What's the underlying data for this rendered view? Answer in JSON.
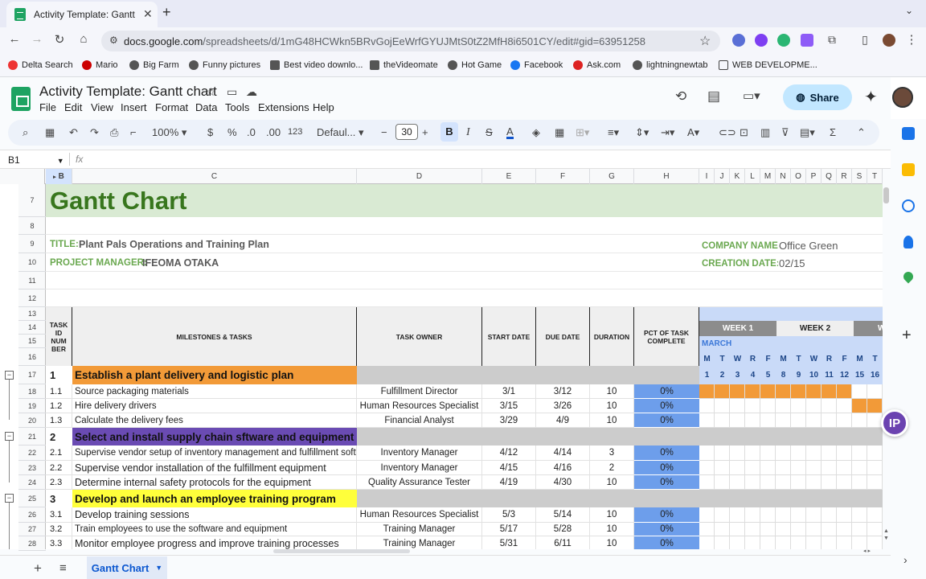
{
  "browser": {
    "tab_title": "Activity Template: Gantt char",
    "tab_close": "✕",
    "new_tab": "+",
    "tab_menu": "⌄",
    "url_host": "docs.google.com",
    "url_path": "/spreadsheets/d/1mG48HCWkn5BRvGojEeWrfGYUJMtS0tZ2MfH8i6501CY/edit#gid=63951258",
    "bookmarks": [
      "Delta Search",
      "Mario",
      "Big Farm",
      "Funny pictures",
      "Best video downlo...",
      "theVideomate",
      "Hot Game",
      "Facebook",
      "Ask.com",
      "lightningnewtab",
      "WEB DEVELOPME..."
    ]
  },
  "app": {
    "doc_title": "Activity Template: Gantt chart",
    "menus": [
      "File",
      "Edit",
      "View",
      "Insert",
      "Format",
      "Data",
      "Tools",
      "Extensions",
      "Help"
    ],
    "share_label": "Share",
    "zoom": "100%",
    "currency": "$",
    "percent": "%",
    "dec_dec": ".0",
    "dec_inc": ".00",
    "num_format": "123",
    "font_name": "Defaul...",
    "font_size": "30",
    "bold": "B",
    "italic": "I",
    "namebox": "B1",
    "fx": "fx",
    "sheet_tab": "Gantt Chart"
  },
  "columns": [
    "B",
    "C",
    "D",
    "E",
    "F",
    "G",
    "H",
    "I",
    "J",
    "K",
    "L",
    "M",
    "N",
    "O",
    "P",
    "Q",
    "R",
    "S",
    "T"
  ],
  "row_numbers": [
    "7",
    "8",
    "9",
    "10",
    "11",
    "12",
    "13",
    "14",
    "15",
    "16",
    "17",
    "18",
    "19",
    "20",
    "21",
    "22",
    "23",
    "24",
    "25",
    "26",
    "27",
    "28"
  ],
  "sheet": {
    "title": "Gantt Chart",
    "title_label": "TITLE:",
    "title_value": "Plant Pals Operations and Training Plan",
    "pm_label": "PROJECT MANAGER:",
    "pm_value": "IFEOMA OTAKA",
    "company_label": "COMPANY NAME:",
    "company_value": "Office Green",
    "creation_label": "CREATION DATE:",
    "creation_value": "02/15",
    "headers": {
      "task_id": "TASK ID NUM BER",
      "milestones": "MILESTONES & TASKS",
      "owner": "TASK OWNER",
      "start": "START DATE",
      "due": "DUE DATE",
      "duration": "DURATION",
      "pct": "PCT OF TASK COMPLETE",
      "week1": "WEEK 1",
      "week2": "WEEK 2",
      "week3": "W",
      "month": "MARCH",
      "days": [
        "M",
        "T",
        "W",
        "R",
        "F",
        "M",
        "T",
        "W",
        "R",
        "F",
        "M",
        "T"
      ],
      "dates": [
        "1",
        "2",
        "3",
        "4",
        "5",
        "8",
        "9",
        "10",
        "11",
        "12",
        "15",
        "16"
      ]
    },
    "phases": [
      {
        "num": "1",
        "name": "Establish a plant delivery and logistic plan",
        "color": "#f29a38",
        "tasks": [
          {
            "id": "1.1",
            "name": "Source packaging materials",
            "owner": "Fulfillment Director",
            "start": "3/1",
            "due": "3/12",
            "duration": "10",
            "pct": "0%"
          },
          {
            "id": "1.2",
            "name": "Hire delivery drivers",
            "owner": "Human Resources Specialist",
            "start": "3/15",
            "due": "3/26",
            "duration": "10",
            "pct": "0%"
          },
          {
            "id": "1.3",
            "name": "Calculate the delivery fees",
            "owner": "Financial Analyst",
            "start": "3/29",
            "due": "4/9",
            "duration": "10",
            "pct": "0%"
          }
        ]
      },
      {
        "num": "2",
        "name": "Select and install supply chain sftware and equipment",
        "color": "#6a4bb3",
        "tasks": [
          {
            "id": "2.1",
            "name": "Supervise vendor setup of inventory management and fulfillment software",
            "owner": "Inventory Manager",
            "start": "4/12",
            "due": "4/14",
            "duration": "3",
            "pct": "0%"
          },
          {
            "id": "2.2",
            "name": "Supervise vendor installation of the fulfillment equipment",
            "owner": "Inventory Manager",
            "start": "4/15",
            "due": "4/16",
            "duration": "2",
            "pct": "0%"
          },
          {
            "id": "2.3",
            "name": "Determine internal safety protocols for the equipment",
            "owner": "Quality Assurance Tester",
            "start": "4/19",
            "due": "4/30",
            "duration": "10",
            "pct": "0%"
          }
        ]
      },
      {
        "num": "3",
        "name": "Develop and launch an employee training program",
        "color": "#ffff3b",
        "tasks": [
          {
            "id": "3.1",
            "name": "Develop training sessions",
            "owner": "Human Resources Specialist",
            "start": "5/3",
            "due": "5/14",
            "duration": "10",
            "pct": "0%"
          },
          {
            "id": "3.2",
            "name": "Train employees to use the software and equipment",
            "owner": "Training Manager",
            "start": "5/17",
            "due": "5/28",
            "duration": "10",
            "pct": "0%"
          },
          {
            "id": "3.3",
            "name": "Monitor employee progress and improve training processes",
            "owner": "Training Manager",
            "start": "5/31",
            "due": "6/11",
            "duration": "10",
            "pct": "0%"
          }
        ]
      }
    ]
  },
  "colors": {
    "header_green": "#d9ead3",
    "title_green": "#38761d",
    "label_green": "#6aa84f",
    "pct_blue": "#6d9eeb",
    "gantt_orange": "#f29a38",
    "week_dark": "#8c8c8c",
    "week_light": "#efefef",
    "march_blue": "#c9daf8"
  }
}
